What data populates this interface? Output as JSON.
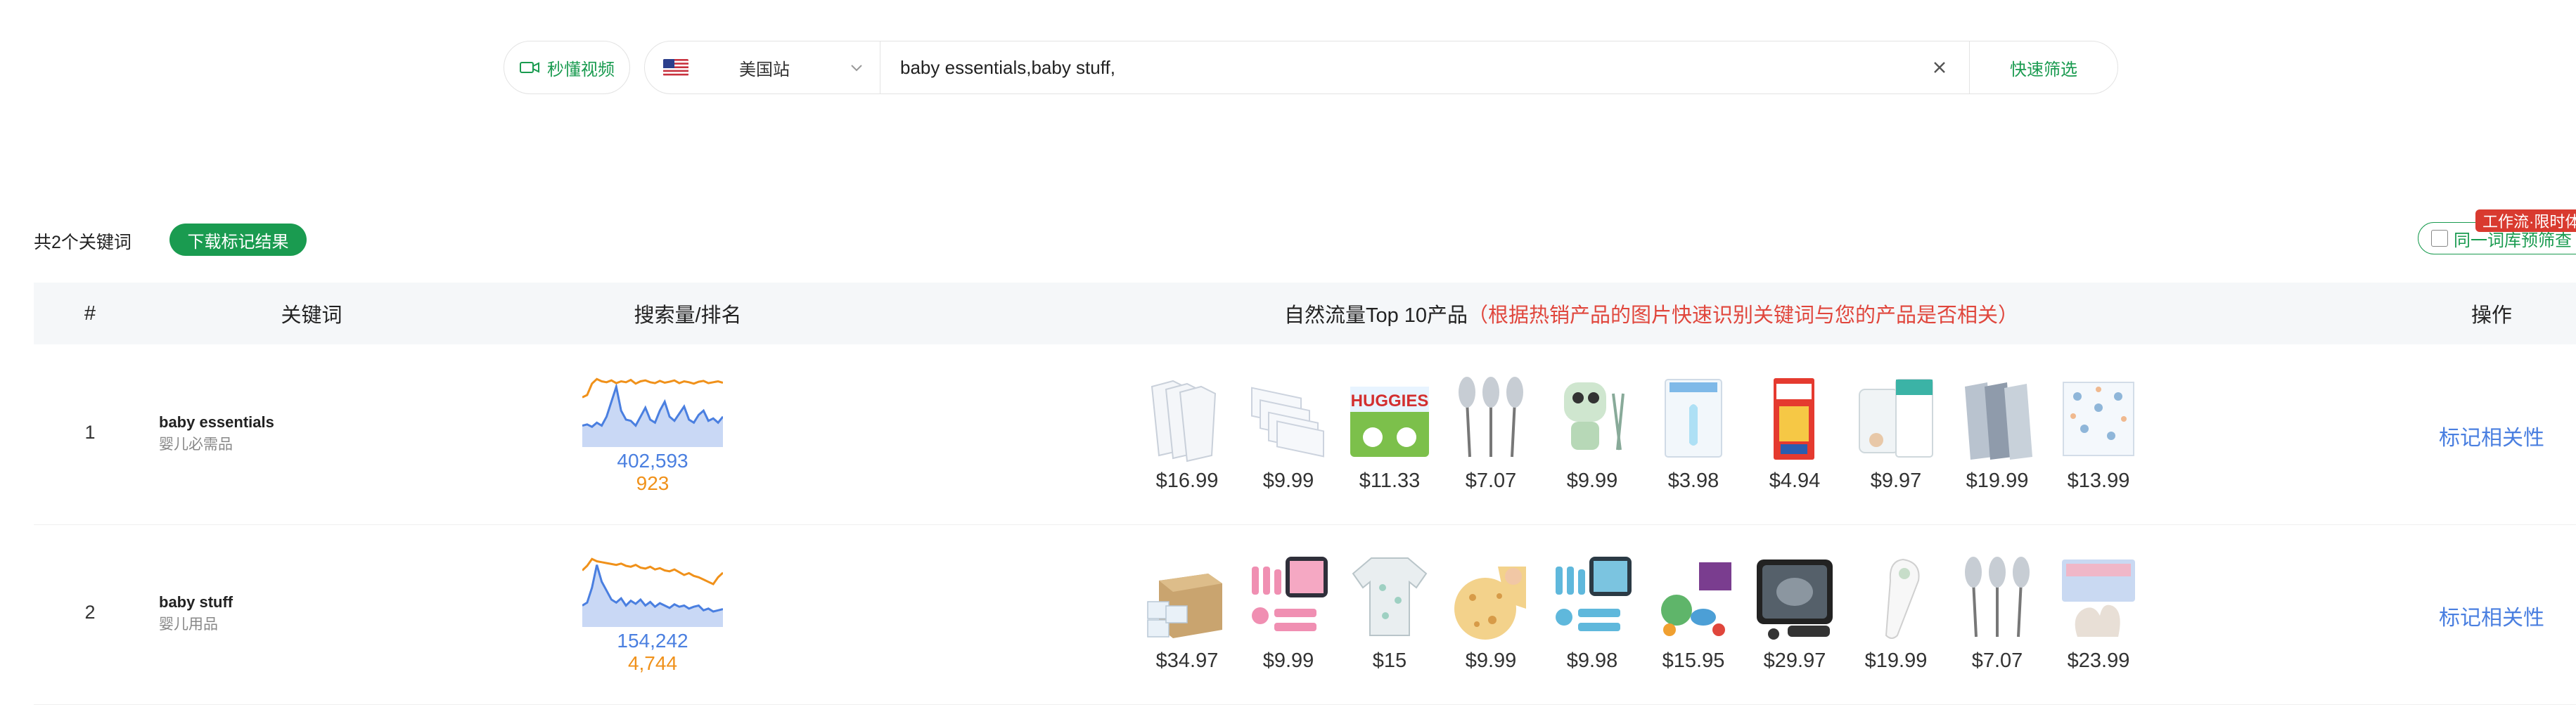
{
  "topbar": {
    "video_button": "秒懂视频",
    "site": "美国站",
    "keywords_value": "baby essentials,baby stuff,",
    "quick_filter": "快速筛选",
    "flag_icon": "us-flag-icon"
  },
  "toolbar": {
    "keyword_count": "共2个关键词",
    "download_button": "下载标记结果",
    "library_checkbox": "同一词库预筛查",
    "promo_badge": "工作流·限时体"
  },
  "table": {
    "headers": {
      "index": "#",
      "keyword": "关键词",
      "volume_rank": "搜索量/排名",
      "top10": "自然流量Top 10产品",
      "top10_note": "（根据热销产品的图片快速识别关键词与您的产品是否相关）",
      "action": "操作"
    },
    "rows": [
      {
        "index": "1",
        "keyword": "baby essentials",
        "keyword_cn": "婴儿必需品",
        "volume": "402,593",
        "rank": "923",
        "trend_volume": [
          0.3,
          0.32,
          0.28,
          0.35,
          0.3,
          0.45,
          0.7,
          0.95,
          0.55,
          0.4,
          0.38,
          0.3,
          0.45,
          0.6,
          0.4,
          0.35,
          0.55,
          0.7,
          0.45,
          0.38,
          0.5,
          0.62,
          0.4,
          0.35,
          0.48,
          0.55,
          0.38,
          0.42,
          0.35,
          0.45
        ],
        "trend_rank": [
          0.55,
          0.6,
          0.85,
          0.95,
          0.9,
          0.88,
          0.92,
          0.86,
          0.9,
          0.88,
          0.93,
          0.85,
          0.9,
          0.92,
          0.88,
          0.86,
          0.91,
          0.87,
          0.89,
          0.92,
          0.86,
          0.9,
          0.88,
          0.85,
          0.89,
          0.91,
          0.86,
          0.88,
          0.9,
          0.87
        ],
        "action": "标记相关性",
        "products": [
          {
            "price": "$16.99",
            "icon": "bodysuit-pack-icon"
          },
          {
            "price": "$9.99",
            "icon": "burp-cloth-icon"
          },
          {
            "price": "$11.33",
            "icon": "huggies-wipes-icon"
          },
          {
            "price": "$7.07",
            "icon": "bottle-brush-icon"
          },
          {
            "price": "$9.99",
            "icon": "nail-trimmer-icon"
          },
          {
            "price": "$3.98",
            "icon": "nasal-aspirator-icon"
          },
          {
            "price": "$4.94",
            "icon": "medicine-box-icon"
          },
          {
            "price": "$9.97",
            "icon": "sound-machine-icon"
          },
          {
            "price": "$19.99",
            "icon": "sleepsuit-icon"
          },
          {
            "price": "$13.99",
            "icon": "swaddle-blanket-icon"
          }
        ]
      },
      {
        "index": "2",
        "keyword": "baby stuff",
        "keyword_cn": "婴儿用品",
        "volume": "154,242",
        "rank": "4,744",
        "trend_volume": [
          0.3,
          0.35,
          0.6,
          0.98,
          0.7,
          0.55,
          0.4,
          0.35,
          0.42,
          0.3,
          0.38,
          0.33,
          0.4,
          0.3,
          0.36,
          0.28,
          0.34,
          0.3,
          0.26,
          0.32,
          0.28,
          0.3,
          0.25,
          0.28,
          0.3,
          0.22,
          0.25,
          0.2,
          0.22,
          0.24
        ],
        "trend_rank": [
          0.7,
          0.8,
          0.95,
          0.9,
          0.88,
          0.86,
          0.84,
          0.82,
          0.85,
          0.8,
          0.78,
          0.82,
          0.76,
          0.74,
          0.78,
          0.72,
          0.75,
          0.7,
          0.68,
          0.72,
          0.66,
          0.6,
          0.64,
          0.58,
          0.55,
          0.5,
          0.45,
          0.4,
          0.55,
          0.65
        ],
        "action": "标记相关性",
        "products": [
          {
            "price": "$34.97",
            "icon": "diaper-box-icon"
          },
          {
            "price": "$9.99",
            "icon": "grooming-kit-icon"
          },
          {
            "price": "$15",
            "icon": "onesie-icon"
          },
          {
            "price": "$9.99",
            "icon": "tortilla-blanket-icon"
          },
          {
            "price": "$9.98",
            "icon": "healthcare-kit-icon"
          },
          {
            "price": "$15.95",
            "icon": "pacifier-toy-icon"
          },
          {
            "price": "$29.97",
            "icon": "car-mirror-icon"
          },
          {
            "price": "$19.99",
            "icon": "thermometer-icon"
          },
          {
            "price": "$7.07",
            "icon": "bottle-brush-icon"
          },
          {
            "price": "$23.99",
            "icon": "handprint-kit-icon"
          }
        ]
      }
    ]
  },
  "colors": {
    "brand_green": "#1a9b50",
    "volume_blue": "#4a7fe0",
    "rank_orange": "#f0911a",
    "note_red": "#e0463c"
  }
}
